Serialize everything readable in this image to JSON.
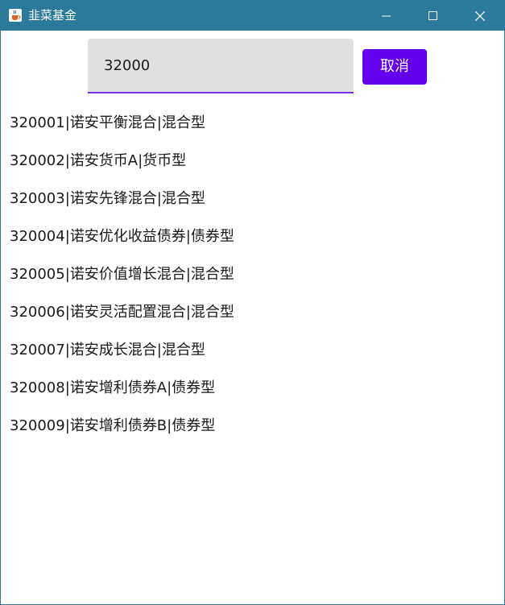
{
  "window": {
    "title": "韭菜基金",
    "icon": "java-cup-icon",
    "controls": [
      "minimize-icon",
      "maximize-icon",
      "close-icon"
    ]
  },
  "search": {
    "value": "32000",
    "cancel_label": "取消"
  },
  "results": [
    "320001|诺安平衡混合|混合型",
    "320002|诺安货币A|货币型",
    "320003|诺安先锋混合|混合型",
    "320004|诺安优化收益债券|债券型",
    "320005|诺安价值增长混合|混合型",
    "320006|诺安灵活配置混合|混合型",
    "320007|诺安成长混合|混合型",
    "320008|诺安增利债券A|债券型",
    "320009|诺安增利债券B|债券型"
  ],
  "colors": {
    "titlebar": "#2b7a9b",
    "accent": "#6200ee",
    "input_underline": "#7a2ee6",
    "input_background": "#e0e0e0"
  }
}
